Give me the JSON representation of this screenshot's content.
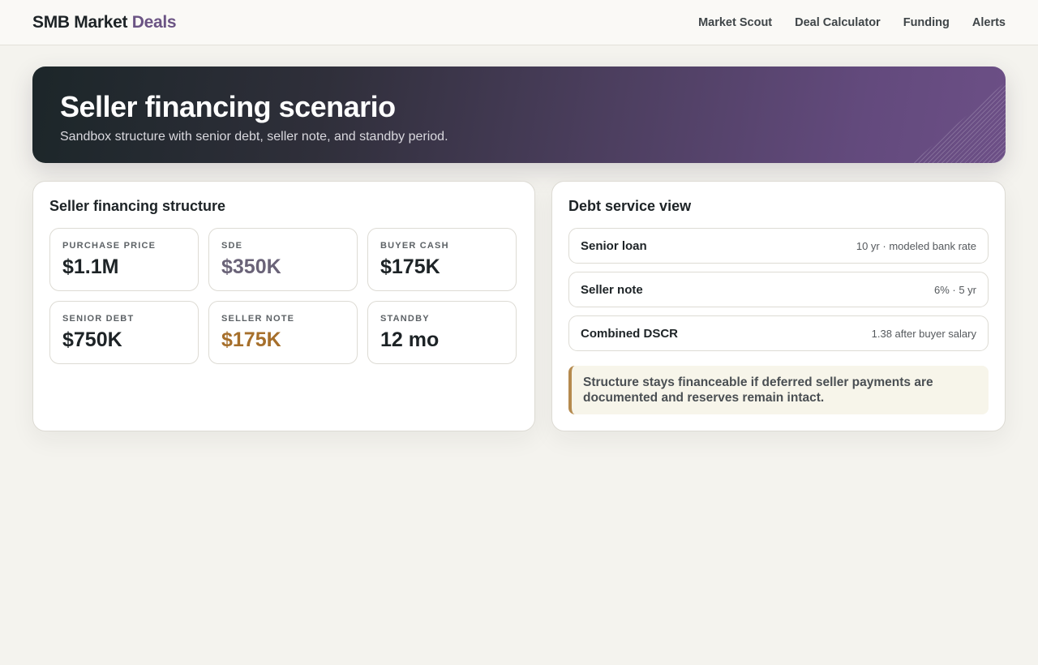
{
  "header": {
    "brand_main": "SMB Market",
    "brand_accent": "Deals",
    "nav": [
      "Market Scout",
      "Deal Calculator",
      "Funding",
      "Alerts"
    ]
  },
  "hero": {
    "title": "Seller financing scenario",
    "subtitle": "Sandbox structure with senior debt, seller note, and standby period."
  },
  "structure": {
    "title": "Seller financing structure",
    "metrics": [
      {
        "label": "Purchase price",
        "value": "$1.1M"
      },
      {
        "label": "SDE",
        "value": "$350K"
      },
      {
        "label": "Buyer cash",
        "value": "$175K"
      },
      {
        "label": "Senior debt",
        "value": "$750K"
      },
      {
        "label": "Seller note",
        "value": "$175K"
      },
      {
        "label": "Standby",
        "value": "12 mo"
      }
    ]
  },
  "debt_service": {
    "title": "Debt service view",
    "rows": [
      {
        "label": "Senior loan",
        "value": "10 yr · modeled bank rate"
      },
      {
        "label": "Seller note",
        "value": "6% · 5 yr"
      },
      {
        "label": "Combined DSCR",
        "value": "1.38 after buyer salary"
      }
    ],
    "note": "Structure stays financeable if deferred seller payments are documented and reserves remain intact."
  },
  "colors": {
    "brand_accent": "#6b5484",
    "sde_value": "#6a6378",
    "seller_note_value": "#a66f2b",
    "note_border": "#b58a4e"
  }
}
